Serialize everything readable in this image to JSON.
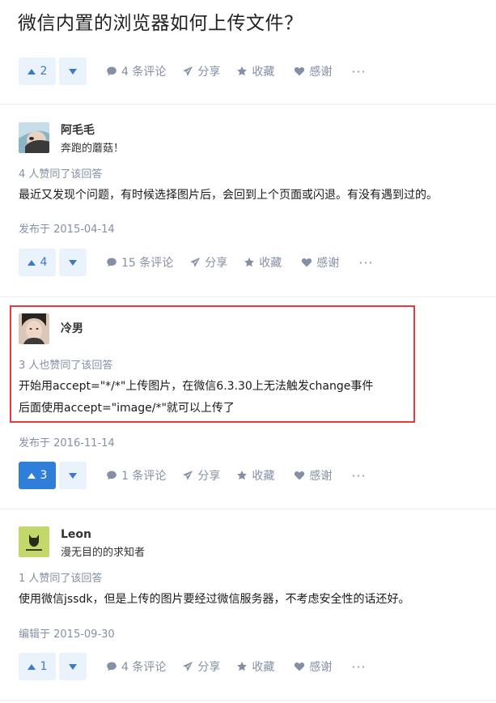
{
  "page": {
    "title": "微信内置的浏览器如何上传文件？"
  },
  "actions_labels": {
    "share": "分享",
    "favorite": "收藏",
    "thanks": "感谢",
    "more": "···"
  },
  "top_actions": {
    "upvotes": "2",
    "comments": "4 条评论"
  },
  "answers": [
    {
      "author": "阿毛毛",
      "bio": "奔跑的蘑菇！",
      "votes_text": "4 人赞同了该回答",
      "content": [
        "最近又发现个问题，有时候选择图片后，会回到上个页面或闪退。有没有遇到过的。"
      ],
      "date": "发布于 2015-04-14",
      "upvotes": "4",
      "comments": "15 条评论",
      "upvote_active": false
    },
    {
      "author": "冷男",
      "bio": "",
      "votes_text": "3 人也赞同了该回答",
      "content": [
        "开始用accept=\"*/*\"上传图片，在微信6.3.30上无法触发change事件",
        "后面使用accept=\"image/*\"就可以上传了"
      ],
      "date": "发布于 2016-11-14",
      "upvotes": "3",
      "comments": "1 条评论",
      "upvote_active": true
    },
    {
      "author": "Leon",
      "bio": "漫无目的的求知者",
      "votes_text": "1 人赞同了该回答",
      "content": [
        "使用微信jssdk，但是上传的图片要经过微信服务器，不考虑安全性的话还好。"
      ],
      "date": "编辑于 2015-09-30",
      "upvotes": "1",
      "comments": "4 条评论",
      "upvote_active": false
    }
  ],
  "colors": {
    "accent": "#2f7ed8",
    "vote_bg": "#eaf2fb",
    "meta": "#8590a6",
    "highlight": "#e8393f"
  },
  "icons": {
    "upvote": "triangle-up-icon",
    "downvote": "triangle-down-icon",
    "comment": "comment-bubble-icon",
    "share": "paper-plane-icon",
    "favorite": "star-icon",
    "thanks": "heart-icon"
  }
}
